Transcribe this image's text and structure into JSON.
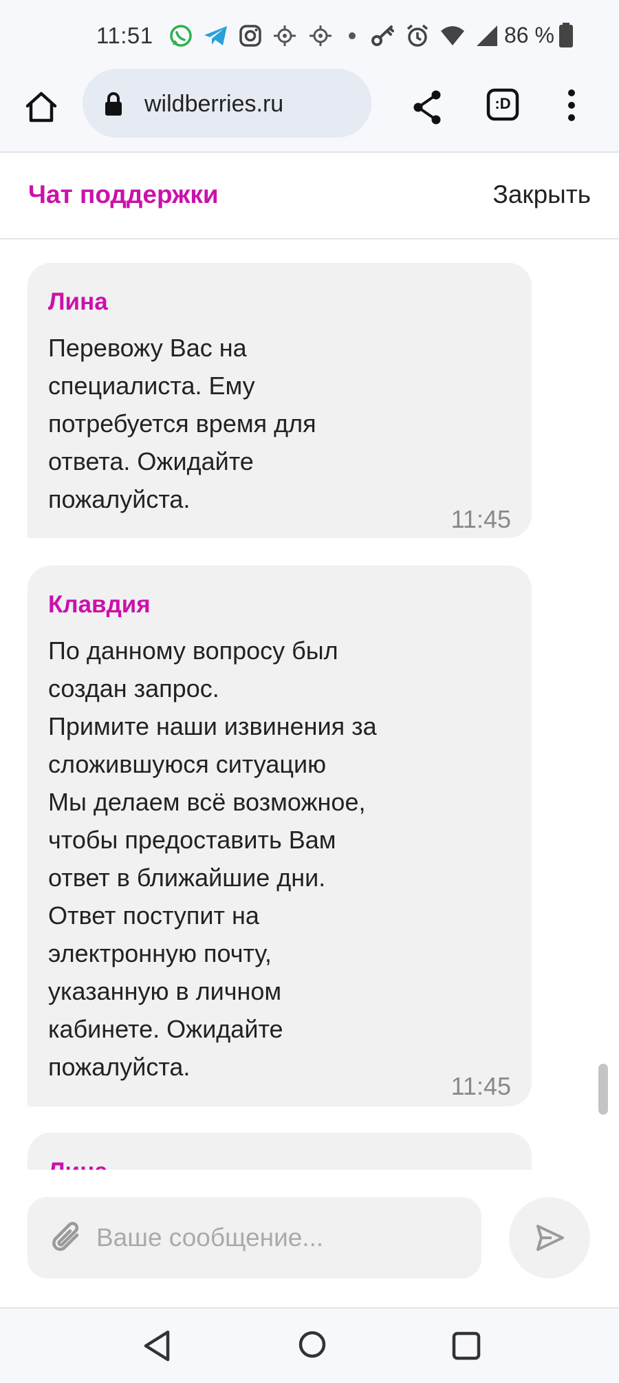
{
  "status_bar": {
    "time": "11:51",
    "battery": "86 %",
    "icons": [
      "whatsapp-icon",
      "telegram-icon",
      "instagram-icon",
      "app-icon",
      "app-icon",
      "dot-icon",
      "key-icon",
      "alarm-icon",
      "wifi-icon",
      "signal-icon",
      "battery-icon"
    ]
  },
  "browser": {
    "url": "wildberries.ru",
    "tab_count": ":D"
  },
  "chat": {
    "title": "Чат поддержки",
    "close_label": "Закрыть",
    "brand_color": "#cb11ab",
    "messages": [
      {
        "author": "Лина",
        "text": "Перевожу Вас на\nспециалиста. Ему\nпотребуется время для\nответа. Ожидайте\nпожалуйста.",
        "time": "11:45"
      },
      {
        "author": "Клавдия",
        "text": "По данному вопросу был\nсоздан запрос.\nПримите наши извинения за\nсложившуюся ситуацию\nМы делаем всё возможное,\nчтобы предоставить Вам\nответ в ближайшие дни.\nОтвет поступит на\nэлектронную почту,\nуказанную в личном\nкабинете. Ожидайте\nпожалуйста.",
        "time": "11:45"
      },
      {
        "author": "Лина",
        "text": "",
        "time": ""
      }
    ]
  },
  "composer": {
    "placeholder": "Ваше сообщение..."
  }
}
